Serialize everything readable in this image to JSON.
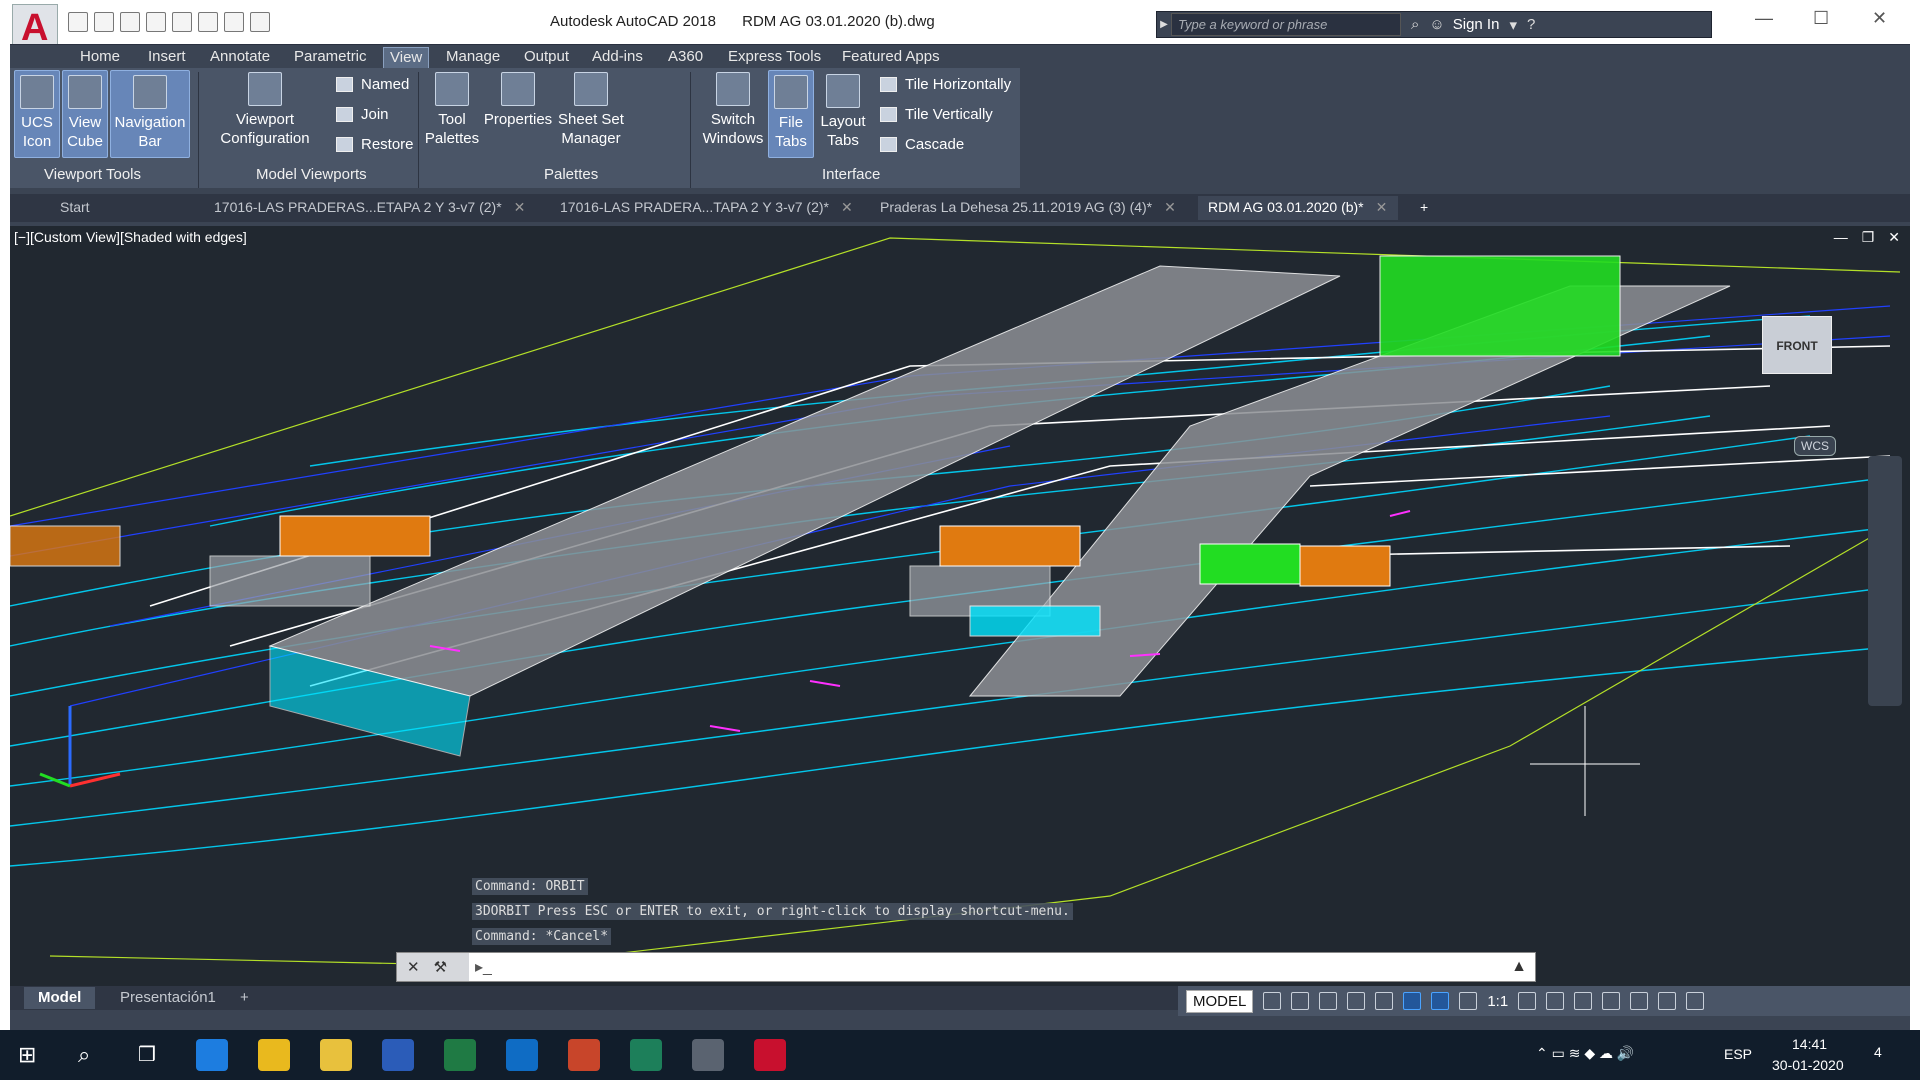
{
  "title": {
    "app": "Autodesk AutoCAD 2018",
    "file": "RDM AG 03.01.2020 (b).dwg"
  },
  "search": {
    "placeholder": "Type a keyword or phrase",
    "sign_in": "Sign In"
  },
  "ribbon_tabs": [
    "Home",
    "Insert",
    "Annotate",
    "Parametric",
    "View",
    "Manage",
    "Output",
    "Add-ins",
    "A360",
    "Express Tools",
    "Featured Apps"
  ],
  "active_tab": "View",
  "panels": {
    "viewport_tools": {
      "label": "Viewport Tools",
      "buttons": [
        "UCS Icon",
        "View Cube",
        "Navigation Bar"
      ]
    },
    "model_viewports": {
      "label": "Model Viewports",
      "config": "Viewport Configuration",
      "small": [
        "Named",
        "Join",
        "Restore"
      ]
    },
    "palettes": {
      "label": "Palettes",
      "buttons": [
        "Tool Palettes",
        "Properties",
        "Sheet Set Manager"
      ]
    },
    "interface": {
      "label": "Interface",
      "buttons": [
        "Switch Windows",
        "File Tabs",
        "Layout Tabs"
      ],
      "small": [
        "Tile Horizontally",
        "Tile Vertically",
        "Cascade"
      ]
    }
  },
  "doc_tabs": [
    "Start",
    "17016-LAS PRADERAS...ETAPA 2 Y 3-v7 (2)*",
    "17016-LAS PRADERA...TAPA 2 Y 3-v7 (2)*",
    "Praderas La Dehesa 25.11.2019 AG (3) (4)*",
    "RDM AG 03.01.2020 (b)*"
  ],
  "active_doc": "RDM AG 03.01.2020 (b)*",
  "viewport": {
    "label": "[−][Custom View][Shaded with edges]",
    "viewcube_face": "FRONT",
    "wcs": "WCS"
  },
  "command_history": [
    "Command: ORBIT",
    "3DORBIT Press ESC or ENTER to exit, or right-click to display shortcut-menu.",
    "Command: *Cancel*"
  ],
  "layout_tabs": [
    "Model",
    "Presentación1"
  ],
  "status": {
    "model": "MODEL",
    "scale": "1:1"
  },
  "taskbar": {
    "lang": "ESP",
    "time": "14:41",
    "date": "30-01-2020",
    "notifications": "4"
  },
  "colors": {
    "ribbon": "#4a5567",
    "viewport_bg": "#212830",
    "cyan": "#00e5ff",
    "orange": "#e07a10",
    "green": "#22dd22",
    "blue": "#1a3cff"
  }
}
